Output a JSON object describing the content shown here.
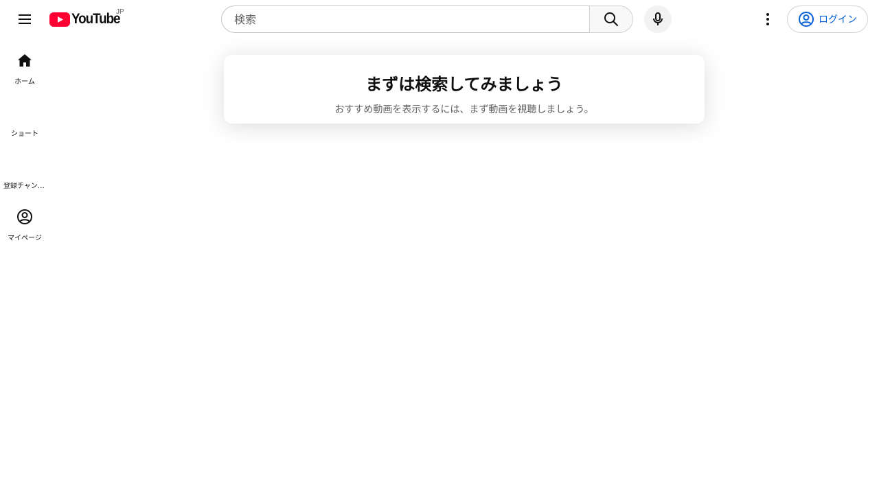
{
  "header": {
    "menu_icon": "hamburger-menu-icon",
    "logo": {
      "wordmark": "YouTube",
      "region": "JP",
      "brand_color": "#ff0033"
    },
    "search": {
      "placeholder": "検索",
      "value": "",
      "search_icon": "search-icon"
    },
    "mic_icon": "microphone-icon",
    "more_icon": "vertical-dots-icon",
    "login": {
      "label": "ログイン",
      "icon": "account-circle-icon",
      "color": "#065fd4"
    }
  },
  "sidebar": {
    "items": [
      {
        "label": "ホーム",
        "icon": "home-icon"
      },
      {
        "label": "ショート",
        "icon": ""
      },
      {
        "label": "登録チャンネル",
        "icon": ""
      },
      {
        "label": "マイページ",
        "icon": "account-circle-icon"
      }
    ]
  },
  "main": {
    "prompt": {
      "title": "まずは検索してみましょう",
      "subtitle": "おすすめ動画を表示するには、まず動画を視聴しましょう。"
    }
  }
}
